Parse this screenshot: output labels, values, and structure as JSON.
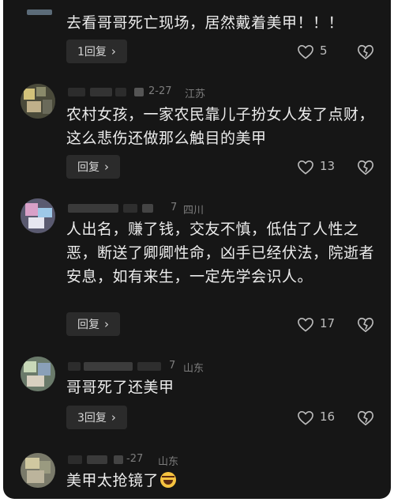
{
  "comments": [
    {
      "text": "去看哥哥死亡现场，居然戴着美甲！！！",
      "reply_label": "1回复",
      "likes": "5",
      "date": "",
      "location": ""
    },
    {
      "text": "农村女孩，一家农民靠儿子扮女人发了点财，这么悲伤还做那么触目的美甲",
      "reply_label": "回复",
      "likes": "13",
      "date": "2-27",
      "location": "江苏"
    },
    {
      "text": "人出名，赚了钱，交友不慎，低估了人性之恶，断送了卿卿性命，凶手已经伏法，院逝者安息，如有来生，一定先学会识人。",
      "reply_label": "回复",
      "likes": "17",
      "date": "7",
      "location": "四川"
    },
    {
      "text": "哥哥死了还美甲",
      "reply_label": "3回复",
      "likes": "16",
      "date": "7",
      "location": "山东"
    },
    {
      "text": "美甲太抢镜了",
      "reply_label": "",
      "likes": "",
      "date": "-27",
      "location": "山东"
    }
  ],
  "icons": {
    "like": "heart-outline-icon",
    "dislike": "broken-heart-icon",
    "reply_chevron": "chevron-right-icon",
    "emoji": "laughing-emoji-icon"
  },
  "colors": {
    "background": "#161616",
    "text": "#ececec",
    "meta": "#7d7d7d",
    "button": "#2b2b2b"
  }
}
